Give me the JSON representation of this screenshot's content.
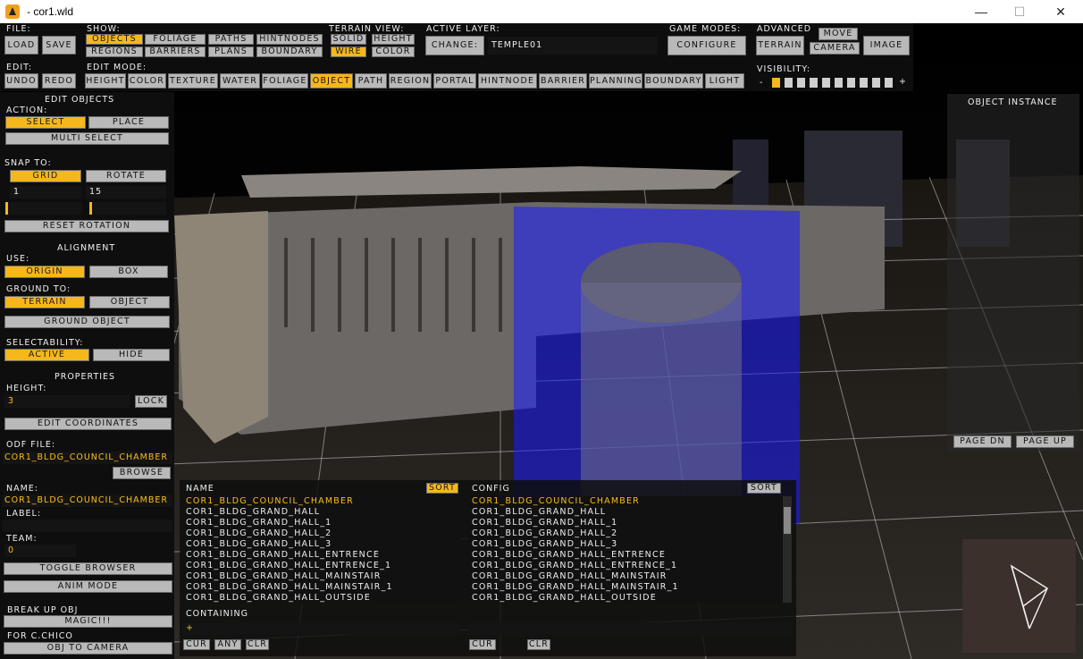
{
  "window": {
    "title": "- cor1.wld",
    "minimize": "—",
    "maximize": "☐",
    "close": "✕"
  },
  "toolbar": {
    "file": {
      "label": "File:",
      "load": "Load",
      "save": "Save"
    },
    "edit": {
      "label": "Edit:",
      "undo": "Undo",
      "redo": "Redo"
    },
    "show": {
      "label": "Show:",
      "items": [
        "Objects",
        "Foliage",
        "Paths",
        "HintNodes",
        "Regions",
        "Barriers",
        "Plans",
        "Boundary"
      ]
    },
    "terrain_view": {
      "label": "Terrain View:",
      "items": [
        "Solid",
        "Height",
        "Wire",
        "Color"
      ]
    },
    "active_layer": {
      "label": "Active Layer:",
      "change": "Change:",
      "value": "Temple01"
    },
    "game_modes": {
      "label": "Game Modes:",
      "configure": "Configure"
    },
    "advanced": {
      "label": "Advanced",
      "move": "Move",
      "terrain": "Terrain",
      "camera": "Camera",
      "image": "Image"
    },
    "edit_mode": {
      "label": "Edit Mode:",
      "items": [
        "Height",
        "Color",
        "Texture",
        "Water",
        "Foliage",
        "Object",
        "Path",
        "Region",
        "Portal",
        "HintNode",
        "Barrier",
        "Planning",
        "Boundary",
        "Light"
      ]
    },
    "visibility": {
      "label": "Visibility:",
      "minus": "-",
      "plus": "+",
      "active_level": 1
    }
  },
  "left": {
    "title": "Edit Objects",
    "action_label": "Action:",
    "select": "Select",
    "place": "Place",
    "multi_select": "Multi Select",
    "snap_label": "Snap To:",
    "grid": "Grid",
    "rotate": "Rotate",
    "grid_value": "1",
    "rotate_value": "15",
    "reset_rotation": "Reset Rotation",
    "alignment": "Alignment",
    "use_label": "Use:",
    "origin": "Origin",
    "box": "Box",
    "ground_label": "Ground To:",
    "terrain": "Terrain",
    "object": "Object",
    "ground_object": "Ground Object",
    "selectability_label": "Selectability:",
    "active": "Active",
    "hide": "Hide",
    "properties": "Properties",
    "height_label": "Height:",
    "height_value": "3",
    "lock": "Lock",
    "edit_coordinates": "Edit Coordinates",
    "odf_label": "Odf File:",
    "odf_value": "Cor1_bldg_Council_Chamber",
    "browse": "Browse",
    "name_label": "Name:",
    "name_value": "Cor1_bldg_Council_Chamber",
    "label_label": "Label:",
    "label_value": "",
    "team_label": "Team:",
    "team_value": "0",
    "toggle_browser": "Toggle Browser",
    "anim_mode": "Anim Mode",
    "break_up": "Break Up Obj",
    "magic": "Magic!!!",
    "for_chico": "For C.Chico",
    "obj_to_camera": "Obj To Camera"
  },
  "browser": {
    "name_header": "Name",
    "config_header": "Config",
    "sort": "Sort",
    "rows": [
      "Cor1_bldg_Council_Chamber",
      "Cor1_bldg_Grand_hall",
      "Cor1_bldg_Grand_hall_1",
      "Cor1_bldg_Grand_hall_2",
      "Cor1_bldg_Grand_hall_3",
      "Cor1_bldg_Grand_hall_entrence",
      "Cor1_bldg_Grand_hall_entrence_1",
      "Cor1_bldg_Grand_hall_mainstair",
      "Cor1_bldg_Grand_hall_mainstair_1",
      "Cor1_bldg_Grand_hall_Outside"
    ],
    "containing": "Containing",
    "containing_value": "+",
    "cur": "Cur",
    "any": "Any",
    "clr": "Clr"
  },
  "right": {
    "title": "Object Instance",
    "page_dn": "Page Dn",
    "page_up": "Page Up"
  },
  "colors": {
    "accent": "#f5b71b",
    "selection_blue": "#1a1aff",
    "button": "#b9b9b9"
  }
}
